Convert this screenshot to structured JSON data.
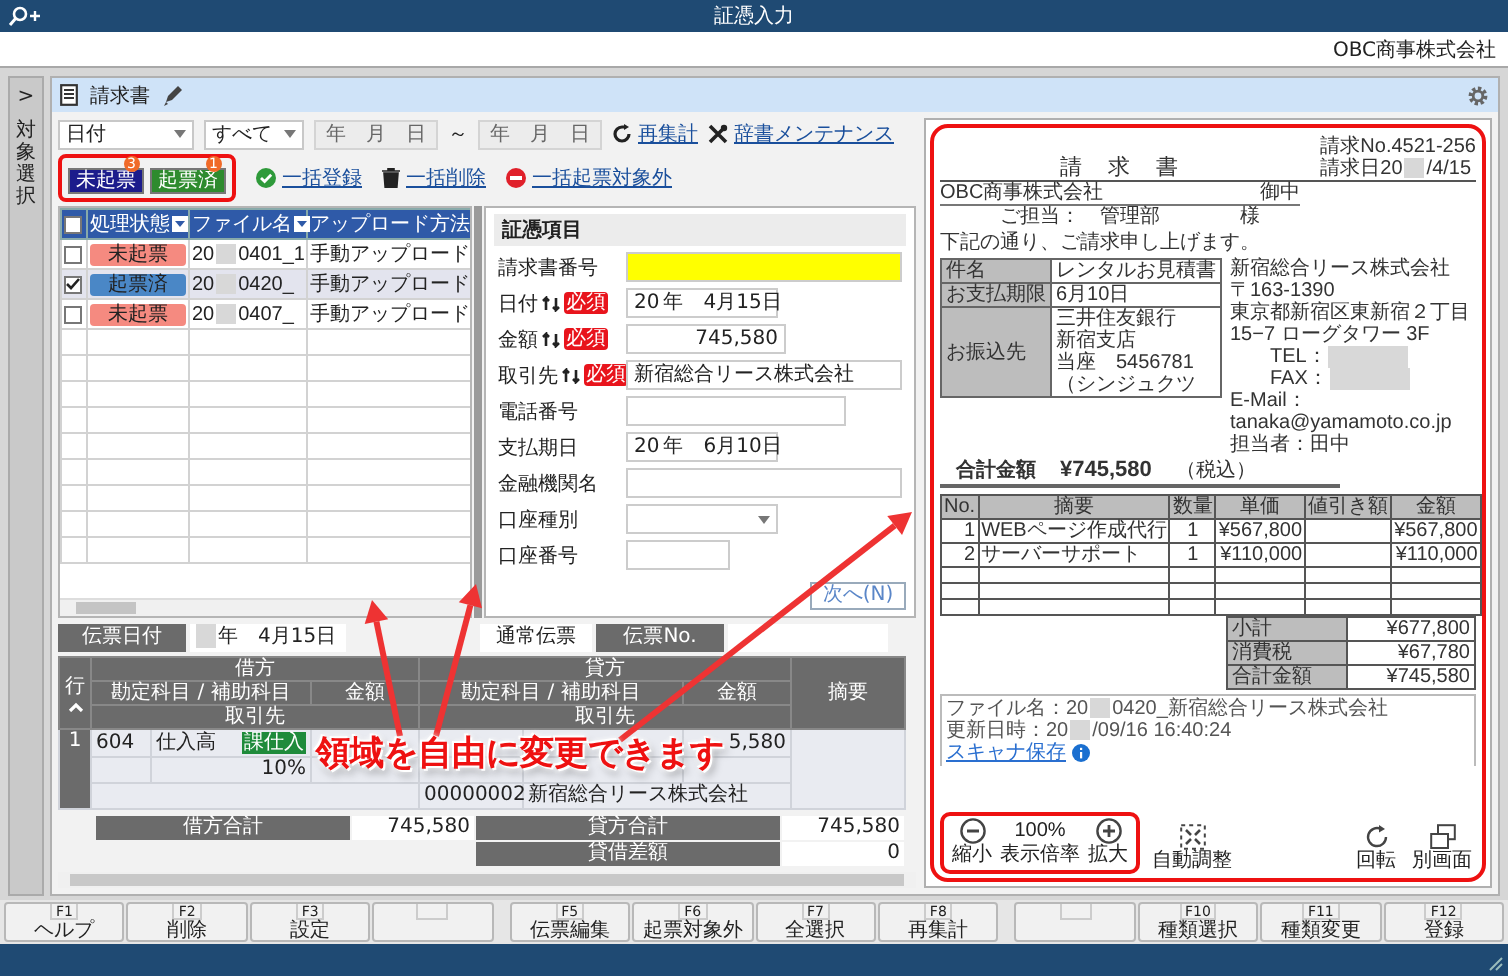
{
  "window": {
    "title": "証憑入力",
    "company": "OBC商事株式会社"
  },
  "side_tab": {
    "arrow": ">",
    "label": "対象選択"
  },
  "toolbar": {
    "document_type": "請求書"
  },
  "filters": {
    "date_field": "日付",
    "scope": "すべて",
    "date_from": "年　月　日",
    "separator": "～",
    "date_to": "年　月　日",
    "links": [
      {
        "label": "再集計",
        "kind": "refresh"
      },
      {
        "label": "辞書メンテナンス",
        "kind": "tools"
      }
    ]
  },
  "status_tabs": [
    {
      "label": "未起票",
      "count": "3",
      "color": "#1c1c8c"
    },
    {
      "label": "起票済",
      "count": "1",
      "color": "#2e8b2e"
    }
  ],
  "bulk_actions": [
    {
      "label": "一括登録",
      "kind": "register"
    },
    {
      "label": "一括削除",
      "kind": "delete"
    },
    {
      "label": "一括起票対象外",
      "kind": "exclude"
    }
  ],
  "file_list": {
    "header_checked": false,
    "columns": [
      "処理状態",
      "ファイル名",
      "アップロード方法"
    ],
    "rows": [
      {
        "checked": false,
        "selected": false,
        "status": "未起票",
        "color": "#f58a80",
        "file_prefix": "20",
        "file_suffix": "0401_1",
        "upload": "手動アップロード"
      },
      {
        "checked": true,
        "selected": true,
        "status": "起票済",
        "color": "#4a87c6",
        "file_prefix": "20",
        "file_suffix": "0420_",
        "upload": "手動アップロード"
      },
      {
        "checked": false,
        "selected": false,
        "status": "未起票",
        "color": "#f58a80",
        "file_prefix": "20",
        "file_suffix": "0407_",
        "upload": "手動アップロード"
      }
    ]
  },
  "form": {
    "title": "証憑項目",
    "fields": [
      {
        "label": "請求書番号",
        "kind": "text",
        "sync": false,
        "highlighted": true
      },
      {
        "label": "日付",
        "kind": "date",
        "sync": true,
        "highlighted": false,
        "badge": "必須",
        "prefix": "20",
        "value": "年　4月15日"
      },
      {
        "label": "金額",
        "kind": "amount",
        "sync": true,
        "highlighted": false,
        "badge": "必須",
        "value": "745,580"
      },
      {
        "label": "取引先",
        "kind": "text",
        "sync": true,
        "highlighted": false,
        "badge": "必須",
        "value": "新宿総合リース株式会社"
      },
      {
        "label": "電話番号",
        "kind": "phone",
        "sync": false,
        "highlighted": false
      },
      {
        "label": "支払期日",
        "kind": "date",
        "sync": false,
        "highlighted": false,
        "prefix": "20",
        "value": "年　6月10日"
      },
      {
        "label": "金融機関名",
        "kind": "text",
        "sync": false,
        "highlighted": false
      },
      {
        "label": "口座種別",
        "kind": "select",
        "sync": false,
        "highlighted": false
      },
      {
        "label": "口座番号",
        "kind": "number",
        "sync": false,
        "highlighted": false
      }
    ],
    "next_button": "次へ(N)"
  },
  "journal": {
    "date_label": "伝票日付",
    "date": "年　4月15日",
    "type": "通常伝票",
    "number_label": "伝票No.",
    "header": {
      "row": "行",
      "debit": {
        "title": "借方",
        "account": "勘定科目 / 補助科目",
        "amount": "金額",
        "partner": "取引先"
      },
      "credit": {
        "title": "貸方",
        "account": "勘定科目 / 補助科目",
        "amount": "金額",
        "partner": "取引先"
      },
      "memo": "摘要"
    },
    "lines": [
      {
        "row": "1",
        "debit_code": "604",
        "debit_account": "仕入高",
        "tax_tag": "課仕入",
        "tax_rate": "10%",
        "credit_amount": "5,580",
        "credit_partner_code": "00000002",
        "credit_partner": "新宿総合リース株式会社"
      }
    ],
    "totals": [
      {
        "label": "借方合計",
        "value": "745,580"
      },
      {
        "label": "貸方合計",
        "value": "745,580"
      },
      {
        "label": "貸借差額",
        "value": "0"
      }
    ]
  },
  "document": {
    "title": "請　求　書",
    "number": "請求No.4521-256",
    "date_prefix": "請求日20",
    "date_suffix": "/4/15",
    "recipient": "OBC商事株式会社",
    "honorific": "御中",
    "attention": "ご担当：　管理部",
    "attention_honorific": "様",
    "greeting": "下記の通り、ご請求申し上げます。",
    "info": [
      {
        "label": "件名",
        "lines": [
          "レンタルお見積書"
        ]
      },
      {
        "label": "お支払期限",
        "lines": [
          "6月10日"
        ]
      },
      {
        "label": "お振込先",
        "lines": [
          "三井住友銀行",
          "新宿支店",
          "当座　5456781",
          "（シンジュクツ"
        ]
      }
    ],
    "issuer": [
      {
        "text": "新宿総合リース株式会社",
        "masked": false
      },
      {
        "text": "〒163-1390",
        "masked": false
      },
      {
        "text": "東京都新宿区東新宿２丁目",
        "masked": false
      },
      {
        "text": "15−7 ローグタワー 3F",
        "masked": false
      },
      {
        "text": "TEL：",
        "masked": true
      },
      {
        "text": "FAX：",
        "masked": true
      },
      {
        "text": "E-Mail：tanaka@yamamoto.co.jp",
        "masked": false
      },
      {
        "text": "担当者：田中",
        "masked": false
      }
    ],
    "total_label": "合計金額",
    "total": "¥745,580",
    "tax_note": "（税込）",
    "item_columns": [
      "No.",
      "摘要",
      "数量",
      "単価",
      "値引き額",
      "金額"
    ],
    "items": [
      {
        "no": "1",
        "description": "WEBページ作成代行",
        "quantity": "1",
        "price": "¥567,800",
        "amount": "¥567,800"
      },
      {
        "no": "2",
        "description": "サーバーサポート",
        "quantity": "1",
        "price": "¥110,000",
        "amount": "¥110,000"
      }
    ],
    "summary": [
      {
        "label": "小計",
        "value": "¥677,800"
      },
      {
        "label": "消費税",
        "value": "¥67,780"
      },
      {
        "label": "合計金額",
        "value": "¥745,580"
      }
    ]
  },
  "file_info": {
    "name_prefix": "ファイル名：20",
    "name_suffix": "0420_新宿総合リース株式会社",
    "updated_prefix": "更新日時：20",
    "updated_suffix": "/09/16 16:40:24",
    "scanner": "スキャナ保存"
  },
  "viewer": {
    "zoom_out": "縮小",
    "zoom": "100%",
    "zoom_label": "表示倍率",
    "zoom_in": "拡大",
    "fit": "自動調整",
    "rotate": "回転",
    "detach": "別画面"
  },
  "function_keys": [
    {
      "kind": "key",
      "key": "F1",
      "label": "ヘルプ"
    },
    {
      "kind": "key",
      "key": "F2",
      "label": "削除"
    },
    {
      "kind": "key",
      "key": "F3",
      "label": "設定"
    },
    {
      "kind": "empty"
    },
    {
      "kind": "key",
      "key": "F5",
      "label": "伝票編集"
    },
    {
      "kind": "key",
      "key": "F6",
      "label": "起票対象外"
    },
    {
      "kind": "key",
      "key": "F7",
      "label": "全選択"
    },
    {
      "kind": "key",
      "key": "F8",
      "label": "再集計"
    },
    {
      "kind": "empty"
    },
    {
      "kind": "key",
      "key": "F10",
      "label": "種類選択"
    },
    {
      "kind": "key",
      "key": "F11",
      "label": "種類変更"
    },
    {
      "kind": "key",
      "key": "F12",
      "label": "登録"
    }
  ],
  "annotation": {
    "caption": "領域を自由に変更できます"
  }
}
